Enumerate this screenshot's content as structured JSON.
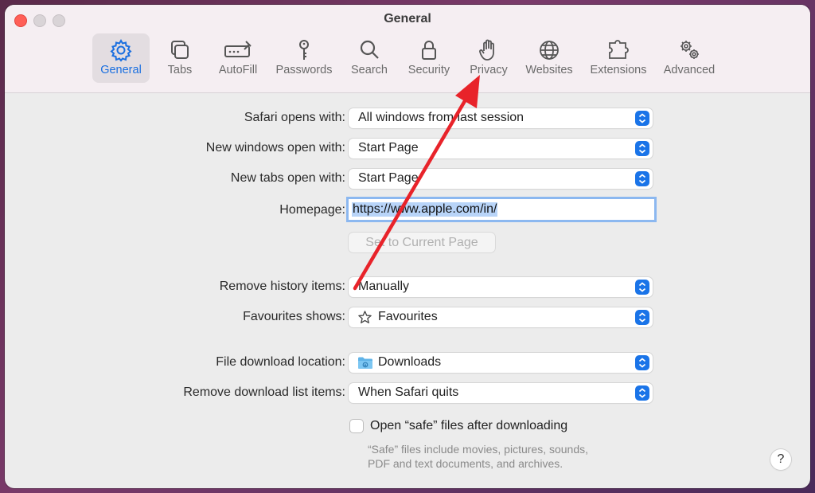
{
  "window": {
    "title": "General"
  },
  "toolbar": {
    "items": [
      {
        "label": "General",
        "icon": "gear-icon",
        "active": true
      },
      {
        "label": "Tabs",
        "icon": "tabs-icon"
      },
      {
        "label": "AutoFill",
        "icon": "autofill-icon"
      },
      {
        "label": "Passwords",
        "icon": "key-icon"
      },
      {
        "label": "Search",
        "icon": "magnifier-icon"
      },
      {
        "label": "Security",
        "icon": "lock-icon"
      },
      {
        "label": "Privacy",
        "icon": "hand-icon"
      },
      {
        "label": "Websites",
        "icon": "globe-icon"
      },
      {
        "label": "Extensions",
        "icon": "puzzle-icon"
      },
      {
        "label": "Advanced",
        "icon": "gears-icon"
      }
    ]
  },
  "settings": {
    "safari_opens_with": {
      "label": "Safari opens with:",
      "value": "All windows from last session"
    },
    "new_windows": {
      "label": "New windows open with:",
      "value": "Start Page"
    },
    "new_tabs": {
      "label": "New tabs open with:",
      "value": "Start Page"
    },
    "homepage": {
      "label": "Homepage:",
      "value": "https://www.apple.com/in/"
    },
    "set_current_page": {
      "label": "Set to Current Page"
    },
    "remove_history": {
      "label": "Remove history items:",
      "value": "Manually"
    },
    "favourites_shows": {
      "label": "Favourites shows:",
      "value": "Favourites",
      "icon": "star-icon"
    },
    "download_location": {
      "label": "File download location:",
      "value": "Downloads",
      "icon": "folder-icon"
    },
    "remove_download_list": {
      "label": "Remove download list items:",
      "value": "When Safari quits"
    },
    "open_safe_files": {
      "label": "Open “safe” files after downloading",
      "checked": false,
      "help_line1": "“Safe” files include movies, pictures, sounds,",
      "help_line2": "PDF and text documents, and archives."
    }
  },
  "help_button": {
    "label": "?"
  },
  "colors": {
    "accent": "#1a74e8",
    "annotation_arrow": "#e8232a"
  }
}
